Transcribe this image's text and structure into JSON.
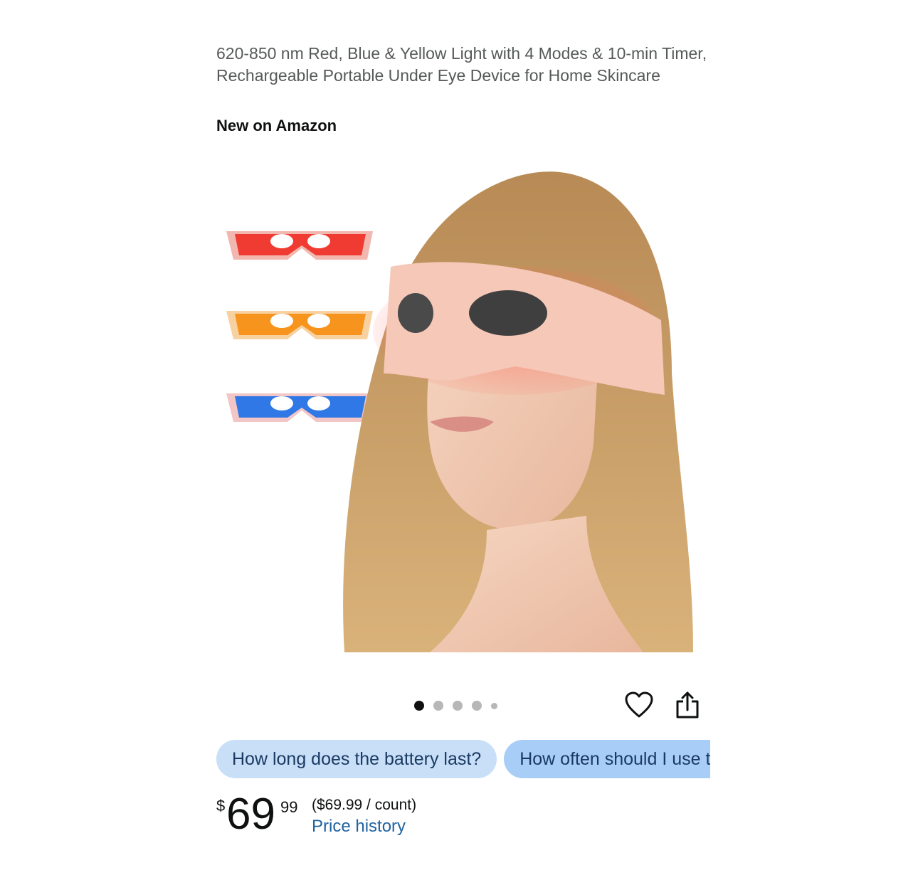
{
  "product": {
    "title": "620-850 nm Red, Blue & Yellow Light with 4 Modes & 10-min Timer, Rechargeable Portable Under Eye Device for Home Skincare",
    "badge": "New on Amazon",
    "image": {
      "alt_icon": "product-photo",
      "light_colors": [
        "#ef3b32",
        "#f7941d",
        "#2f78e6"
      ]
    }
  },
  "carousel": {
    "total_dots": 5,
    "active_index": 0
  },
  "actions": {
    "wishlist_icon": "heart-icon",
    "share_icon": "share-icon"
  },
  "questions": [
    {
      "label": "How long does the battery last?"
    },
    {
      "label": "How often should I use this device?"
    }
  ],
  "price": {
    "currency": "$",
    "whole": "69",
    "fraction": "99",
    "unit_price": "($69.99 / count)",
    "history_label": "Price history"
  }
}
